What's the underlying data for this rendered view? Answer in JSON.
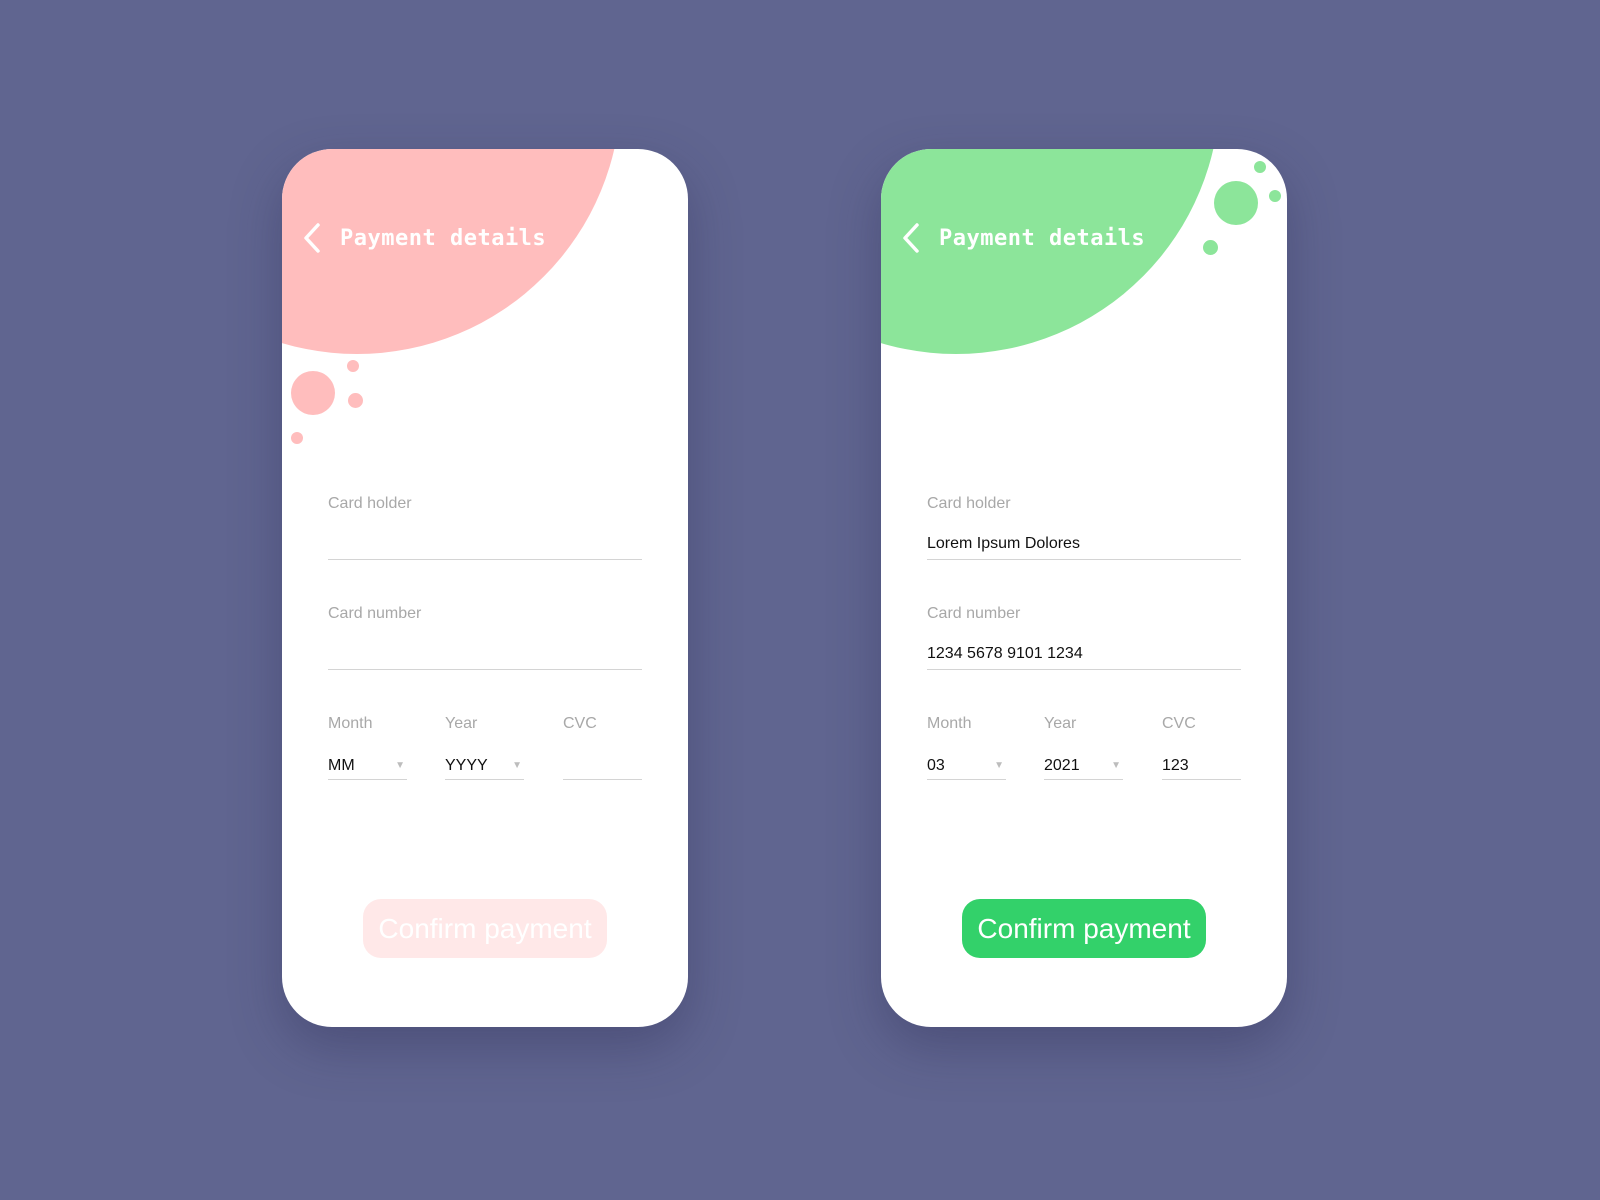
{
  "colors": {
    "background": "#606590",
    "disabled_accent": "#FFBDBD",
    "disabled_button": "#FFE8E8",
    "enabled_accent": "#8CE59A",
    "enabled_button": "#33D16A"
  },
  "screens": [
    {
      "state": "empty",
      "header": {
        "back_icon": "chevron-left-icon",
        "title": "Payment details"
      },
      "card_holder": {
        "label": "Card holder",
        "value": ""
      },
      "card_number": {
        "label": "Card number",
        "value": ""
      },
      "month": {
        "label": "Month",
        "value": "MM"
      },
      "year": {
        "label": "Year",
        "value": "YYYY"
      },
      "cvc": {
        "label": "CVC",
        "value": ""
      },
      "confirm_button": {
        "label": "Confirm payment",
        "enabled": false
      }
    },
    {
      "state": "filled",
      "header": {
        "back_icon": "chevron-left-icon",
        "title": "Payment details"
      },
      "card_holder": {
        "label": "Card holder",
        "value": "Lorem Ipsum Dolores"
      },
      "card_number": {
        "label": "Card number",
        "value": "1234 5678 9101 1234"
      },
      "month": {
        "label": "Month",
        "value": "03"
      },
      "year": {
        "label": "Year",
        "value": "2021"
      },
      "cvc": {
        "label": "CVC",
        "value": "123"
      },
      "confirm_button": {
        "label": "Confirm payment",
        "enabled": true
      }
    }
  ]
}
